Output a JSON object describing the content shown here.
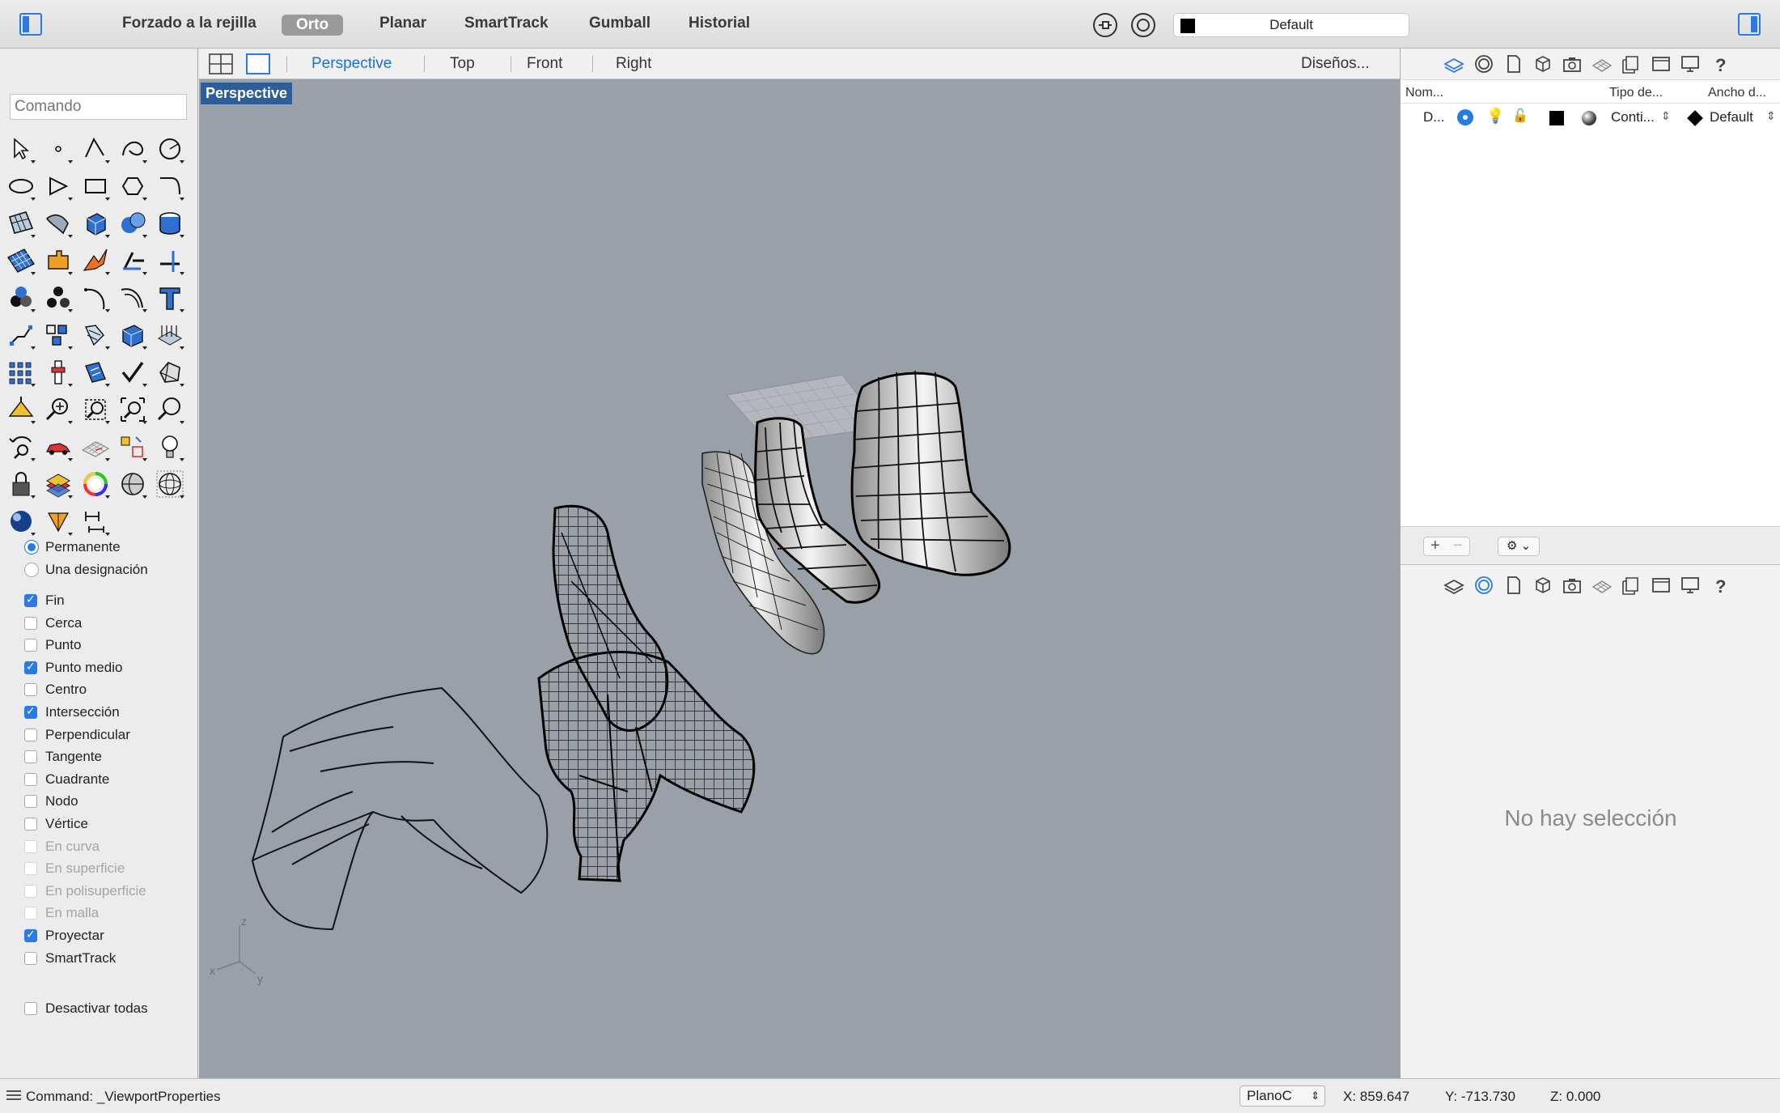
{
  "topbar": {
    "items": [
      "Forzado a la rejilla",
      "Orto",
      "Planar",
      "SmartTrack",
      "Gumball",
      "Historial"
    ],
    "active_item": "Orto",
    "layer_name": "Default",
    "layer_color": "#000000"
  },
  "command": {
    "placeholder": "Comando"
  },
  "tool_icons": [
    "select-arrow-icon",
    "point-icon",
    "polyline-icon",
    "curve-icon",
    "circle-icon",
    "ellipse-icon",
    "polygon-icon",
    "rectangle-icon",
    "freeform-icon",
    "fillet-curve-icon",
    "surface-corner-icon",
    "surface-patch-icon",
    "box-solid-icon",
    "sphere-solid-icon",
    "cylinder-icon",
    "surface-grid-icon",
    "explode-puzzle-icon",
    "boolean-union-icon",
    "split-icon",
    "trim-icon",
    "group-icon",
    "ungroup-icon",
    "arc-curve-icon",
    "offset-curve-icon",
    "text-icon",
    "move-icon",
    "array-icon",
    "flow-icon",
    "box-edit-icon",
    "hatch-icon",
    "grid-array-icon",
    "pipeline-icon",
    "analyze-icon",
    "check-icon",
    "mesh-icon",
    "render-light-icon",
    "zoom-in-icon",
    "zoom-window-icon",
    "zoom-extents-icon",
    "zoom-icon",
    "rotate-view-icon",
    "car-block-icon",
    "cplane-icon",
    "layout-icon",
    "light-bulb-icon",
    "lock-icon",
    "layer-material-icon",
    "color-wheel-icon",
    "sphere-shade-icon",
    "wireframe-sphere-icon",
    "render-sphere-icon",
    "gumball-icon",
    "dimension-icon"
  ],
  "snaps": {
    "modes": [
      {
        "label": "Permanente",
        "on": true
      },
      {
        "label": "Una designación",
        "on": false
      }
    ],
    "items": [
      {
        "label": "Fin",
        "on": true,
        "disabled": false
      },
      {
        "label": "Cerca",
        "on": false,
        "disabled": false
      },
      {
        "label": "Punto",
        "on": false,
        "disabled": false
      },
      {
        "label": "Punto medio",
        "on": true,
        "disabled": false
      },
      {
        "label": "Centro",
        "on": false,
        "disabled": false
      },
      {
        "label": "Intersección",
        "on": true,
        "disabled": false
      },
      {
        "label": "Perpendicular",
        "on": false,
        "disabled": false
      },
      {
        "label": "Tangente",
        "on": false,
        "disabled": false
      },
      {
        "label": "Cuadrante",
        "on": false,
        "disabled": false
      },
      {
        "label": "Nodo",
        "on": false,
        "disabled": false
      },
      {
        "label": "Vértice",
        "on": false,
        "disabled": false
      },
      {
        "label": "En curva",
        "on": false,
        "disabled": true
      },
      {
        "label": "En superficie",
        "on": false,
        "disabled": true
      },
      {
        "label": "En polisuperficie",
        "on": false,
        "disabled": true
      },
      {
        "label": "En malla",
        "on": false,
        "disabled": true
      },
      {
        "label": "Proyectar",
        "on": true,
        "disabled": false
      },
      {
        "label": "SmartTrack",
        "on": false,
        "disabled": false
      }
    ],
    "disable_all": "Desactivar todas"
  },
  "viewport_tabs": {
    "tabs": [
      "Perspective",
      "Top",
      "Front",
      "Right"
    ],
    "active": "Perspective",
    "layouts": "Diseños..."
  },
  "viewport": {
    "label": "Perspective",
    "axis_labels": {
      "x": "x",
      "y": "y",
      "z": "z"
    }
  },
  "layers_panel": {
    "headers": {
      "name": "Nom...",
      "linetype": "Tipo de...",
      "width": "Ancho d..."
    },
    "row": {
      "name": "D...",
      "linetype": "Conti...",
      "width": "Default",
      "color": "#000000"
    }
  },
  "properties": {
    "empty": "No hay selección"
  },
  "status": {
    "command": "Command: _ViewportProperties",
    "cplane": "PlanoC",
    "x": "X: 859.647",
    "y": "Y: -713.730",
    "z": "Z: 0.000"
  }
}
